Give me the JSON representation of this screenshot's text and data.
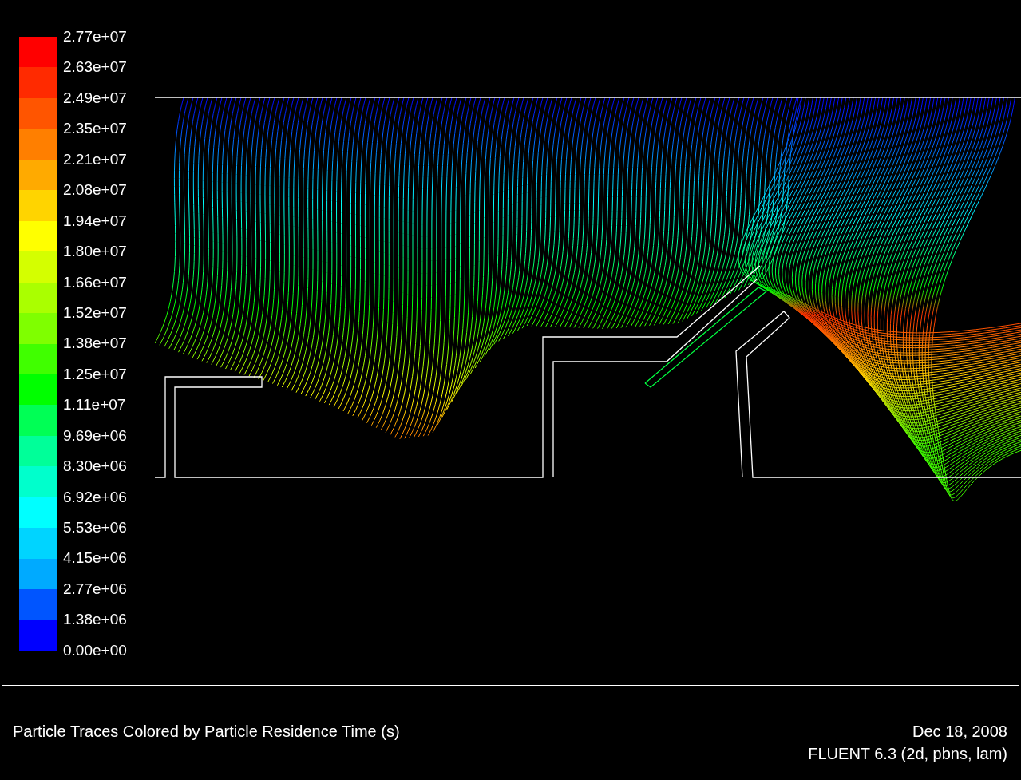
{
  "legend": {
    "labels": [
      "2.77e+07",
      "2.63e+07",
      "2.49e+07",
      "2.35e+07",
      "2.21e+07",
      "2.08e+07",
      "1.94e+07",
      "1.80e+07",
      "1.66e+07",
      "1.52e+07",
      "1.38e+07",
      "1.25e+07",
      "1.11e+07",
      "9.69e+06",
      "8.30e+06",
      "6.92e+06",
      "5.53e+06",
      "4.15e+06",
      "2.77e+06",
      "1.38e+06",
      "0.00e+00"
    ],
    "bands": [
      {
        "color": "#ff0000"
      },
      {
        "color": "#ff2a00"
      },
      {
        "color": "#ff5500"
      },
      {
        "color": "#ff7f00"
      },
      {
        "color": "#ffaa00"
      },
      {
        "color": "#ffd400"
      },
      {
        "color": "#ffff00"
      },
      {
        "color": "#d4ff00"
      },
      {
        "color": "#aaff00"
      },
      {
        "color": "#7fff00"
      },
      {
        "color": "#40ff00"
      },
      {
        "color": "#00ff00"
      },
      {
        "color": "#00ff55"
      },
      {
        "color": "#00ff99"
      },
      {
        "color": "#00ffcc"
      },
      {
        "color": "#00ffff"
      },
      {
        "color": "#00d4ff"
      },
      {
        "color": "#00aaff"
      },
      {
        "color": "#0055ff"
      },
      {
        "color": "#0000ff"
      }
    ]
  },
  "footer": {
    "title": "Particle Traces Colored by Particle Residence Time (s)",
    "date": "Dec 18, 2008",
    "version": "FLUENT 6.3 (2d, pbns, lam)"
  }
}
